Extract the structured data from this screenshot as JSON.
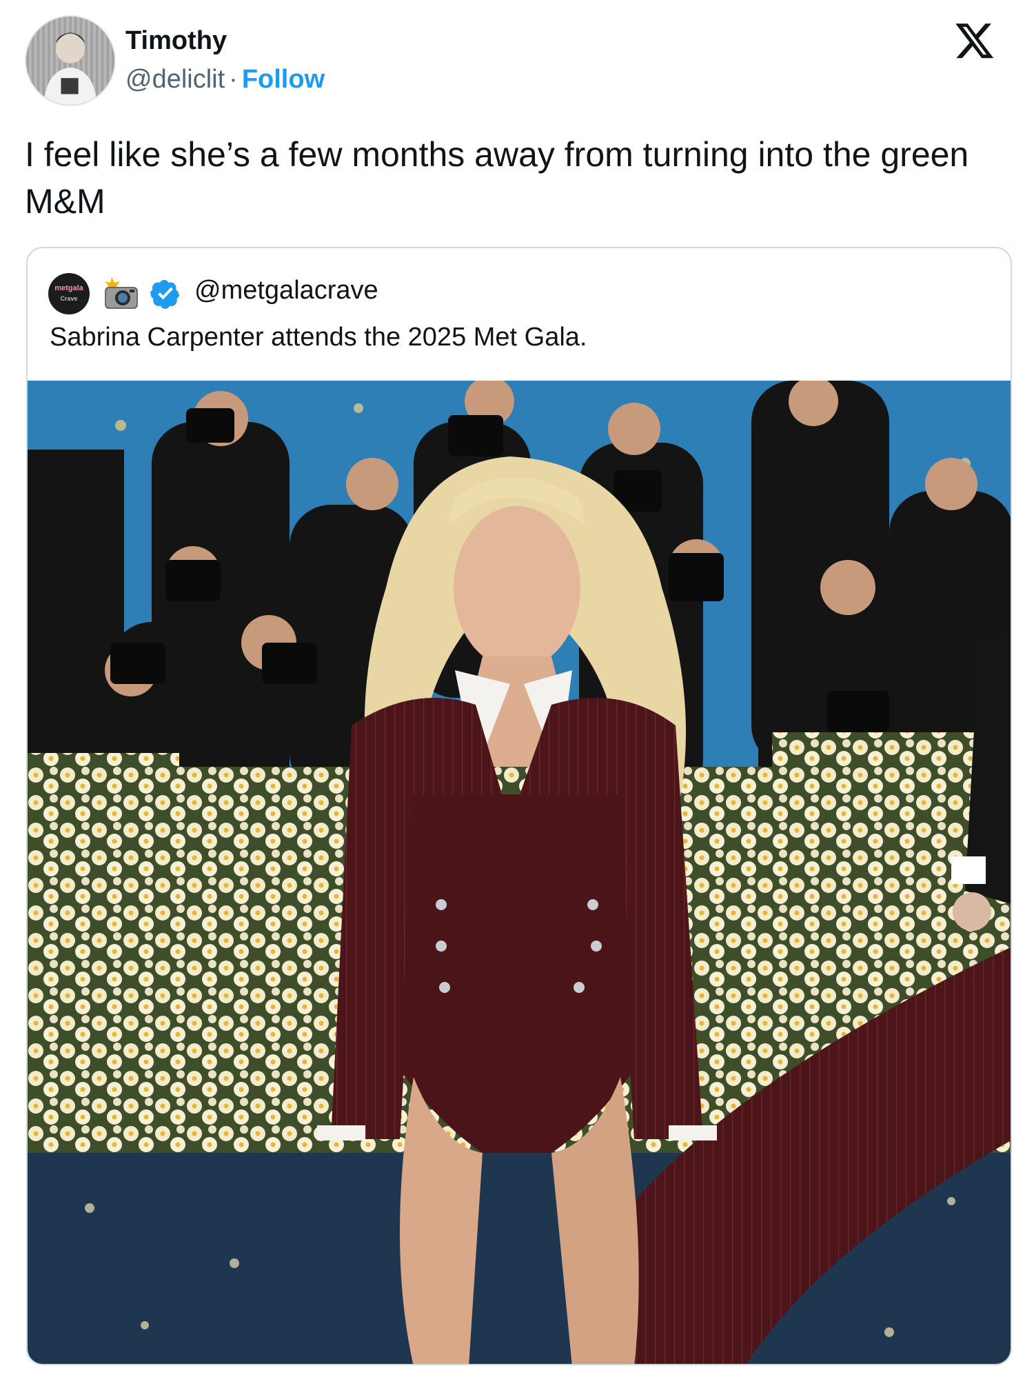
{
  "author": {
    "name": "Timothy",
    "handle": "@deliclit",
    "separator": "·",
    "follow_label": "Follow"
  },
  "platform_icon": "x-logo-icon",
  "tweet": {
    "text": "I feel like she’s a few months away from turning into the green M&M"
  },
  "quoted_tweet": {
    "handle": "@metgalacrave",
    "avatar_text_line1": "metgala",
    "avatar_text_line2": "Crave",
    "icons": [
      "camera-flash-icon",
      "verified-badge-icon"
    ],
    "text": "Sabrina Carpenter attends the 2025 Met Gala.",
    "media": "photo-icon"
  },
  "colors": {
    "accent": "#1d9bf0",
    "text": "#0f1419",
    "muted": "#536471",
    "border": "#cfd9de",
    "backdrop_blue": "#2f7fb7",
    "suit": "#4a1418"
  }
}
